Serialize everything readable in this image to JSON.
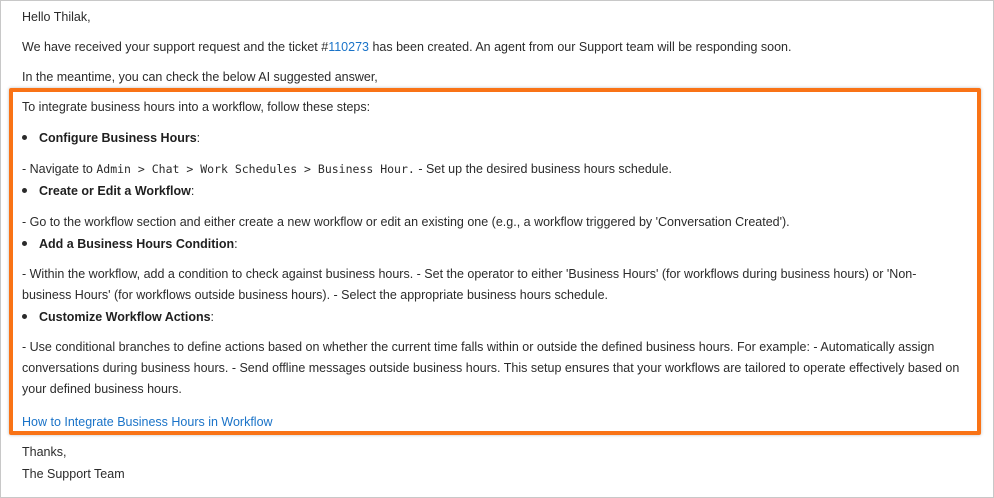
{
  "email": {
    "greeting": "Hello Thilak,",
    "intro_before": "We have received your support request and the ticket #",
    "ticket_number": "110273",
    "intro_after": " has been created. An agent from our Support team will be responding soon.",
    "meantime": "In the meantime, you can check the below AI suggested answer,",
    "closing_thanks": "Thanks,",
    "closing_sign": "The Support Team"
  },
  "answer": {
    "lead": "To integrate business hours into a workflow, follow these steps:",
    "steps": [
      {
        "heading": "Configure Business Hours",
        "detail_prefix": "- Navigate to ",
        "detail_path": "Admin > Chat > Work Schedules > Business Hour.",
        "detail_suffix": " - Set up the desired business hours schedule."
      },
      {
        "heading": "Create or Edit a Workflow",
        "detail": "- Go to the workflow section and either create a new workflow or edit an existing one (e.g., a workflow triggered by 'Conversation Created')."
      },
      {
        "heading": "Add a Business Hours Condition",
        "detail": "- Within the workflow, add a condition to check against business hours. - Set the operator to either 'Business Hours' (for workflows during business hours) or 'Non-business Hours' (for workflows outside business hours). - Select the appropriate business hours schedule."
      },
      {
        "heading": "Customize Workflow Actions",
        "detail": "- Use conditional branches to define actions based on whether the current time falls within or outside the defined business hours. For example: - Automatically assign conversations during business hours. - Send offline messages outside business hours. This setup ensures that your workflows are tailored to operate effectively based on your defined business hours."
      }
    ],
    "heading_suffix": ":",
    "link_label": "How to Integrate Business Hours in Workflow"
  },
  "colors": {
    "highlight_border": "#f97316",
    "link": "#1a73c8",
    "text": "#2b2b2b"
  }
}
